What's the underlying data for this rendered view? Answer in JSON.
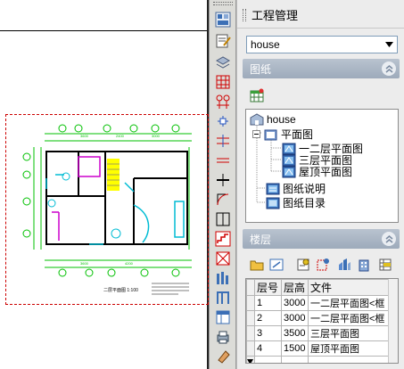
{
  "panel": {
    "title": "工程管理",
    "project_select": "house",
    "sections": {
      "drawings": "图纸",
      "floors": "楼层"
    }
  },
  "tree": {
    "root": "house",
    "plan": "平面图",
    "items": [
      "一二层平面图",
      "三层平面图",
      "屋顶平面图"
    ],
    "notes": "图纸说明",
    "catalog": "图纸目录"
  },
  "floors_table": {
    "headers": [
      "层号",
      "层高",
      "文件"
    ],
    "rows": [
      [
        "1",
        "3000",
        "一二层平面图<框"
      ],
      [
        "2",
        "3000",
        "一二层平面图<框"
      ],
      [
        "3",
        "3500",
        "三层平面图"
      ],
      [
        "4",
        "1500",
        "屋顶平面图"
      ]
    ]
  },
  "drawing": {
    "caption": "二层平面图 1:100"
  },
  "colors": {
    "section_header": "#9daabb",
    "frame_border": "#cc0000",
    "grid_line": "#00c000"
  }
}
